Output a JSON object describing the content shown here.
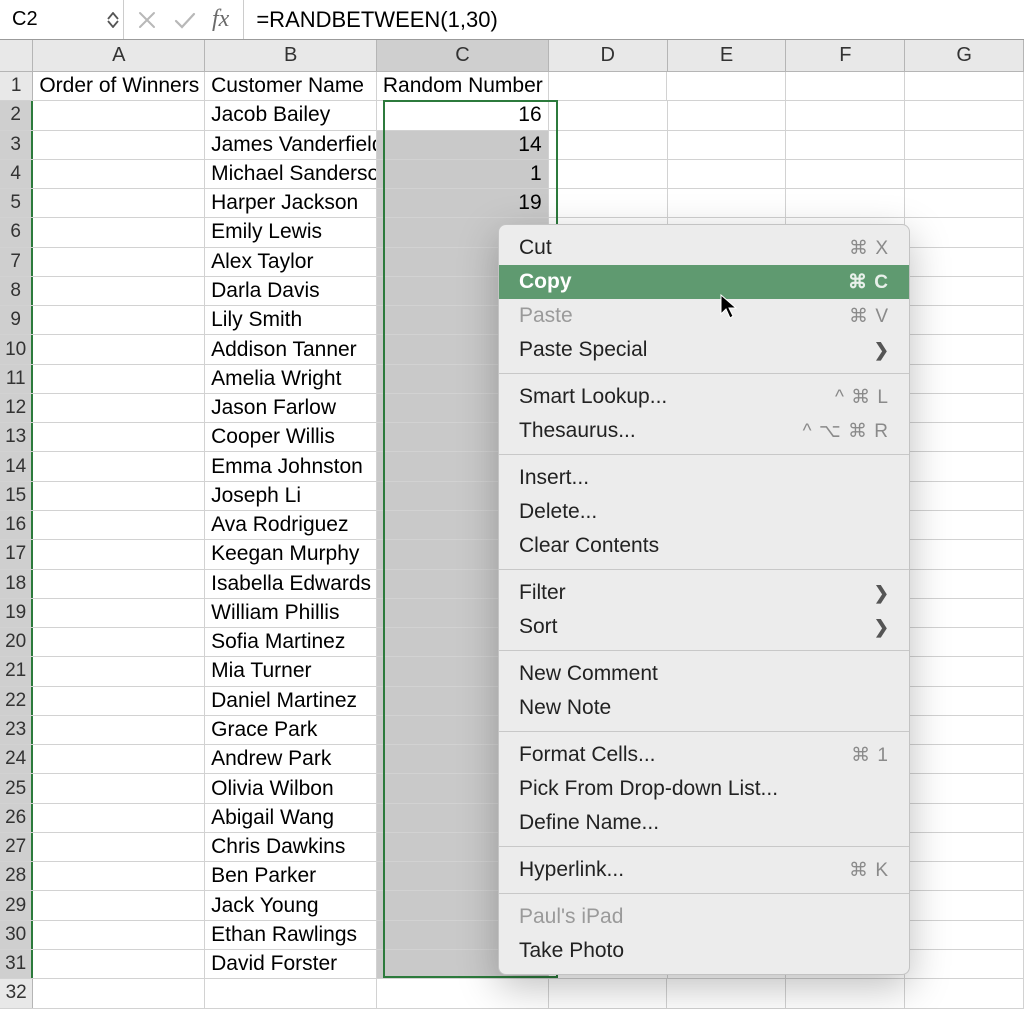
{
  "formula_bar": {
    "cell_ref": "C2",
    "fx_label": "fx",
    "formula": "=RANDBETWEEN(1,30)"
  },
  "columns": [
    "A",
    "B",
    "C",
    "D",
    "E",
    "F",
    "G"
  ],
  "headers": {
    "A": "Order of Winners",
    "B": "Customer Name",
    "C": "Random Number"
  },
  "customers": [
    {
      "name": "Jacob Bailey",
      "rand": "16"
    },
    {
      "name": "James Vanderfield",
      "rand": "14"
    },
    {
      "name": "Michael Sanderson",
      "rand": "1"
    },
    {
      "name": "Harper Jackson",
      "rand": "19"
    },
    {
      "name": "Emily Lewis",
      "rand": ""
    },
    {
      "name": "Alex Taylor",
      "rand": ""
    },
    {
      "name": "Darla Davis",
      "rand": ""
    },
    {
      "name": "Lily Smith",
      "rand": ""
    },
    {
      "name": "Addison Tanner",
      "rand": ""
    },
    {
      "name": "Amelia Wright",
      "rand": ""
    },
    {
      "name": "Jason Farlow",
      "rand": ""
    },
    {
      "name": "Cooper Willis",
      "rand": ""
    },
    {
      "name": "Emma Johnston",
      "rand": ""
    },
    {
      "name": "Joseph Li",
      "rand": ""
    },
    {
      "name": "Ava Rodriguez",
      "rand": ""
    },
    {
      "name": "Keegan Murphy",
      "rand": ""
    },
    {
      "name": "Isabella Edwards",
      "rand": ""
    },
    {
      "name": "William Phillis",
      "rand": ""
    },
    {
      "name": "Sofia Martinez",
      "rand": ""
    },
    {
      "name": "Mia Turner",
      "rand": ""
    },
    {
      "name": "Daniel Martinez",
      "rand": ""
    },
    {
      "name": "Grace Park",
      "rand": ""
    },
    {
      "name": "Andrew Park",
      "rand": ""
    },
    {
      "name": "Olivia Wilbon",
      "rand": ""
    },
    {
      "name": "Abigail Wang",
      "rand": ""
    },
    {
      "name": "Chris Dawkins",
      "rand": ""
    },
    {
      "name": "Ben Parker",
      "rand": ""
    },
    {
      "name": "Jack Young",
      "rand": ""
    },
    {
      "name": "Ethan Rawlings",
      "rand": ""
    },
    {
      "name": "David Forster",
      "rand": ""
    }
  ],
  "extra_rows": [
    32
  ],
  "context_menu": {
    "groups": [
      [
        {
          "label": "Cut",
          "shortcut": "⌘ X",
          "disabled": false,
          "hover": false
        },
        {
          "label": "Copy",
          "shortcut": "⌘ C",
          "disabled": false,
          "hover": true
        },
        {
          "label": "Paste",
          "shortcut": "⌘ V",
          "disabled": true,
          "hover": false
        },
        {
          "label": "Paste Special",
          "sub": true
        }
      ],
      [
        {
          "label": "Smart Lookup...",
          "shortcut": "^ ⌘ L"
        },
        {
          "label": "Thesaurus...",
          "shortcut": "^ ⌥ ⌘ R"
        }
      ],
      [
        {
          "label": "Insert..."
        },
        {
          "label": "Delete..."
        },
        {
          "label": "Clear Contents"
        }
      ],
      [
        {
          "label": "Filter",
          "sub": true
        },
        {
          "label": "Sort",
          "sub": true
        }
      ],
      [
        {
          "label": "New Comment"
        },
        {
          "label": "New Note"
        }
      ],
      [
        {
          "label": "Format Cells...",
          "shortcut": "⌘ 1"
        },
        {
          "label": "Pick From Drop-down List..."
        },
        {
          "label": "Define Name..."
        }
      ],
      [
        {
          "label": "Hyperlink...",
          "shortcut": "⌘ K"
        }
      ],
      [
        {
          "label": "Paul's iPad",
          "disabled": true
        },
        {
          "label": "Take Photo"
        }
      ]
    ]
  }
}
